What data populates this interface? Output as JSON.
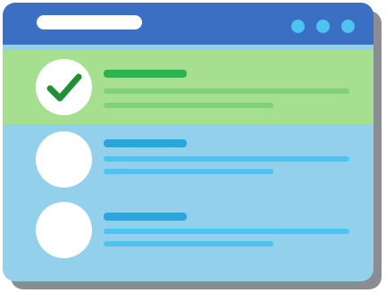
{
  "window": {
    "titlebar_color": "#3b6fc4",
    "body_color": "#93d0ec",
    "shadow_color": "#8a8d92",
    "window_controls": [
      "dot",
      "dot",
      "dot"
    ]
  },
  "list": {
    "items": [
      {
        "state": "checked",
        "highlight_color": "#a5df8f",
        "icon": "checkmark-icon"
      },
      {
        "state": "unchecked",
        "icon": "empty-circle"
      },
      {
        "state": "unchecked",
        "icon": "empty-circle"
      }
    ]
  },
  "colors": {
    "accent_green": "#2eb352",
    "accent_blue": "#2ea4dc",
    "line_green": "#7fcf7b",
    "line_blue": "#4ec3ef"
  }
}
